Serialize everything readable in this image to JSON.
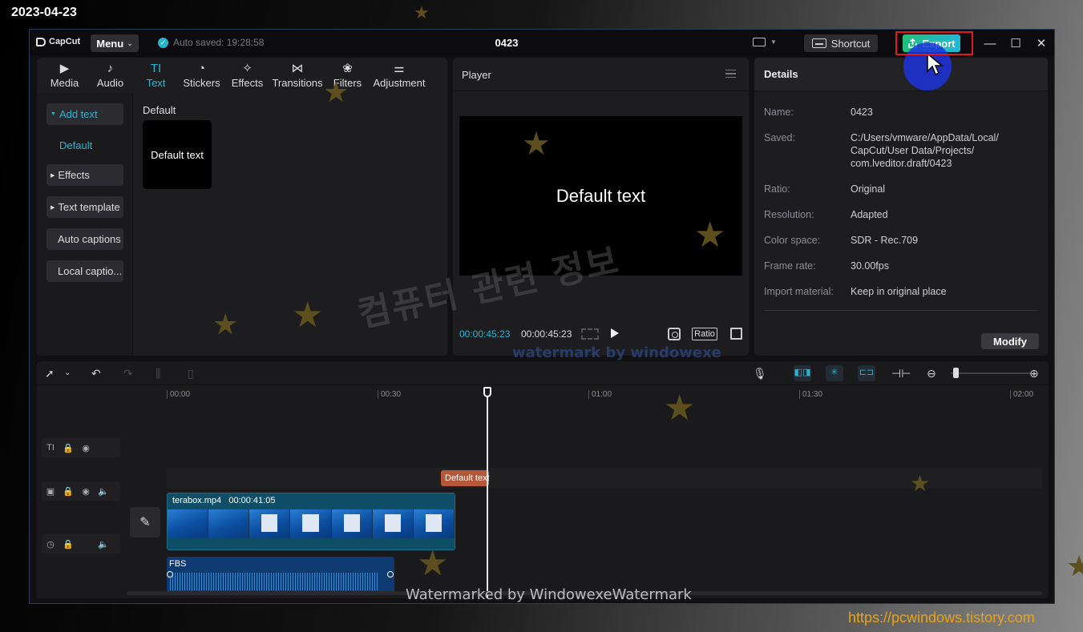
{
  "overlay": {
    "date": "2023-04-23",
    "site": "https://pcwindows.tistory.com",
    "korean_watermark": "컴퓨터 관련 정보",
    "small_watermark": "watermark by windowexe",
    "bottom_watermark": "Watermarked by WindowexeWatermark"
  },
  "titlebar": {
    "app_name": "CapCut",
    "menu_label": "Menu",
    "autosave_text": "Auto saved: 19:28:58",
    "project_title": "0423",
    "shortcut_label": "Shortcut",
    "export_label": "Export"
  },
  "media_panel": {
    "tabs": [
      {
        "label": "Media",
        "icon": "media-icon"
      },
      {
        "label": "Audio",
        "icon": "audio-icon"
      },
      {
        "label": "Text",
        "icon": "text-icon"
      },
      {
        "label": "Stickers",
        "icon": "stickers-icon"
      },
      {
        "label": "Effects",
        "icon": "effects-icon"
      },
      {
        "label": "Transitions",
        "icon": "transitions-icon"
      },
      {
        "label": "Filters",
        "icon": "filters-icon"
      },
      {
        "label": "Adjustment",
        "icon": "adjustment-icon"
      }
    ],
    "active_tab": "Text",
    "sidebar": {
      "add_text": "Add text",
      "default": "Default",
      "effects": "Effects",
      "text_template": "Text template",
      "auto_captions": "Auto captions",
      "local_captions": "Local captio..."
    },
    "section_label": "Default",
    "card_label": "Default text"
  },
  "player": {
    "title": "Player",
    "preview_text": "Default text",
    "current_time": "00:00:45:23",
    "total_time": "00:00:45:23",
    "ratio_label": "Ratio"
  },
  "details": {
    "title": "Details",
    "rows": [
      {
        "label": "Name:",
        "value": "0423"
      },
      {
        "label": "Saved:",
        "value": "C:/Users/vmware/AppData/Local/\nCapCut/User Data/Projects/\ncom.lveditor.draft/0423"
      },
      {
        "label": "Ratio:",
        "value": "Original"
      },
      {
        "label": "Resolution:",
        "value": "Adapted"
      },
      {
        "label": "Color space:",
        "value": "SDR - Rec.709"
      },
      {
        "label": "Frame rate:",
        "value": "30.00fps"
      },
      {
        "label": "Import material:",
        "value": "Keep in original place"
      }
    ],
    "modify_label": "Modify"
  },
  "timeline": {
    "ruler": [
      "00:00",
      "00:30",
      "01:00",
      "01:30",
      "02:00"
    ],
    "text_clip": "Default text",
    "video_clip": {
      "name": "terabox.mp4",
      "duration": "00:00:41:05"
    },
    "audio_clip": "FBS",
    "zoom_level": 0.05
  },
  "colors": {
    "accent": "#27b4d0",
    "export_gradient_start": "#22c07b",
    "export_gradient_end": "#1fb8d8",
    "text_clip": "#b5583a",
    "video_clip": "#0e4f67",
    "audio_clip": "#0d3a70",
    "highlight_box": "#e01a1a",
    "site_url": "#e8a317"
  }
}
